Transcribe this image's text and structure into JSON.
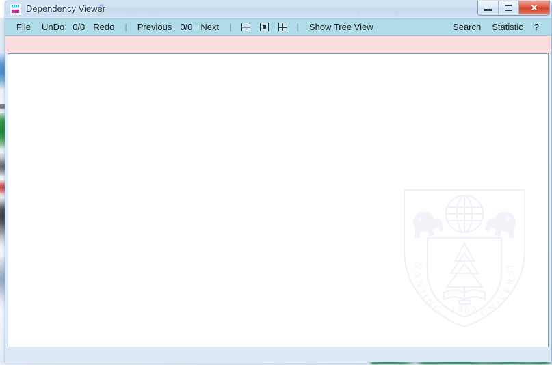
{
  "window": {
    "title": "Dependency Viewer",
    "icon": "app-icon",
    "controls": {
      "minimize": "minimize-button",
      "maximize": "maximize-button",
      "close": "close-button",
      "close_glyph": "✕"
    },
    "ghost_text_left": "...  ...  ......  ......",
    "ghost_text_right": "......   |   ......   |   ......"
  },
  "menu": {
    "left_items": [
      {
        "label": "File",
        "name": "menu-file",
        "type": "item"
      },
      {
        "label": "UnDo",
        "name": "menu-undo",
        "type": "item"
      },
      {
        "label": "0/0",
        "name": "undo-counter",
        "type": "counter"
      },
      {
        "label": "Redo",
        "name": "menu-redo",
        "type": "item"
      },
      {
        "label": "|",
        "name": "menu-separator-1",
        "type": "separator"
      },
      {
        "label": "Previous",
        "name": "menu-previous",
        "type": "item"
      },
      {
        "label": "0/0",
        "name": "navigation-counter",
        "type": "counter"
      },
      {
        "label": "Next",
        "name": "menu-next",
        "type": "item"
      },
      {
        "label": "|",
        "name": "menu-separator-2",
        "type": "separator"
      }
    ],
    "layout_icons": [
      {
        "name": "layout-split-horizontal-icon",
        "kind": "split-h"
      },
      {
        "name": "layout-single-pane-icon",
        "kind": "single"
      },
      {
        "name": "layout-grid-icon",
        "kind": "grid"
      }
    ],
    "tree_view_label": "Show Tree View",
    "right_items": [
      {
        "label": "Search",
        "name": "menu-search"
      },
      {
        "label": "Statistic",
        "name": "menu-statistic"
      },
      {
        "label": "?",
        "name": "menu-help"
      }
    ]
  },
  "watermark": {
    "name": "nanjing-university-crest-watermark",
    "year": "1902",
    "text_left": "NANJING",
    "text_right": "UNIVERSITY"
  },
  "colors": {
    "menu_bar": "#b0dbe8",
    "status_band": "#fcdde0",
    "title_bar": "#d3e3f3",
    "content": "#ffffff",
    "close_button": "#cc3f25",
    "title_text": "#14375e"
  }
}
